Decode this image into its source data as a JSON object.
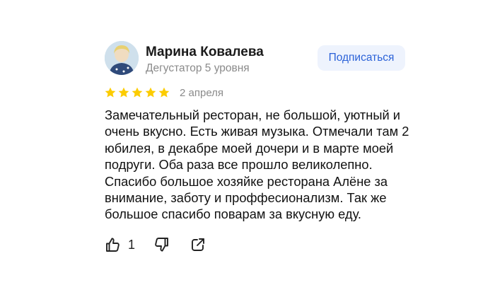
{
  "review": {
    "author": {
      "name": "Марина Ковалева",
      "level": "Дегустатор 5 уровня"
    },
    "subscribe_label": "Подписаться",
    "rating": 5,
    "date": "2 апреля",
    "text": "Замечательный ресторан, не большой, уютный и очень вкусно. Есть живая музыка. Отмечали там 2 юбилея, в декабре моей дочери и в марте моей подруги. Оба раза все прошло великолепно. Спасибо большое хозяйке ресторана Алёне за внимание, заботу и проффесионализм. Так же большое спасибо поварам за вкусную еду.",
    "likes": "1"
  },
  "colors": {
    "star": "#fccc00",
    "accent": "#2b62d8",
    "button_bg": "#eef3fd",
    "muted": "#8a8a8a"
  },
  "icons": {
    "like": "thumbs-up-icon",
    "dislike": "thumbs-down-icon",
    "share": "share-icon"
  }
}
